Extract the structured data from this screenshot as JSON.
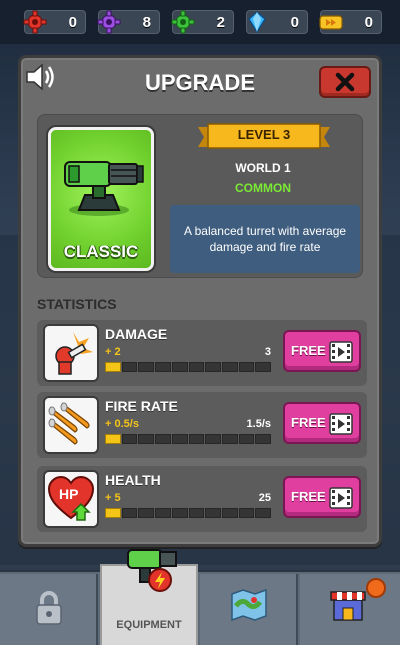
{
  "currencies": [
    {
      "name": "red-gear",
      "value": "0",
      "color": "#e2342a"
    },
    {
      "name": "purple-gear",
      "value": "8",
      "color": "#9a4fe0"
    },
    {
      "name": "green-gear",
      "value": "2",
      "color": "#3ac23a"
    },
    {
      "name": "blue-gem",
      "value": "0",
      "color": "#37b6ff"
    },
    {
      "name": "ticket",
      "value": "0",
      "color": "#f7c325"
    }
  ],
  "modal": {
    "title": "UPGRADE",
    "item": {
      "name": "CLASSIC",
      "level": "LEVEL 3",
      "world": "WORLD 1",
      "rarity": "COMMON",
      "description": "A balanced turret with average damage and fire rate"
    },
    "statistics_title": "STATISTICS",
    "free_label": "FREE",
    "stats": [
      {
        "name": "DAMAGE",
        "bonus": "+ 2",
        "value": "3",
        "filled": 1,
        "total": 10
      },
      {
        "name": "FIRE RATE",
        "bonus": "+ 0.5/s",
        "value": "1.5/s",
        "filled": 1,
        "total": 10
      },
      {
        "name": "HEALTH",
        "bonus": "+ 5",
        "value": "25",
        "filled": 1,
        "total": 10
      }
    ]
  },
  "nav": {
    "tabs": [
      {
        "id": "locked",
        "label": "",
        "icon": "padlock-icon"
      },
      {
        "id": "equipment",
        "label": "EQUIPMENT",
        "icon": "turret-icon",
        "active": true
      },
      {
        "id": "map",
        "label": "",
        "icon": "map-icon"
      },
      {
        "id": "shop",
        "label": "",
        "icon": "shop-icon"
      }
    ]
  },
  "colors": {
    "accent_pink": "#e13f9f",
    "ribbon_gold": "#f4c419",
    "rarity_green": "#7bea34",
    "close_red": "#c8382f"
  }
}
